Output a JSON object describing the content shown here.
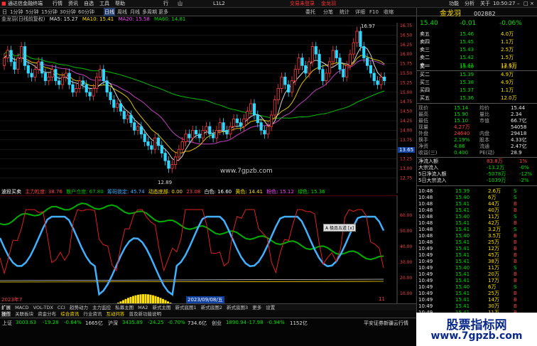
{
  "menu": {
    "app_title": "通达信金融终端",
    "items": [
      "行情",
      "资讯",
      "自选",
      "工具",
      "帮助",
      "行",
      "山",
      "L1L2"
    ],
    "login": "交易未登录",
    "stock_short": "金龙羽",
    "right_items": [
      "功能",
      "分析",
      "关于",
      "三"
    ]
  },
  "toolbar": {
    "items": [
      "日",
      "1分钟",
      "5分钟",
      "15分钟",
      "30分钟",
      "60分钟",
      "日线",
      "周线",
      "月线",
      "多周期",
      "更多"
    ],
    "right_items": [
      "委托",
      "分笔",
      "统计",
      "详细",
      "F10",
      "收缩"
    ]
  },
  "chart": {
    "main_info": "金龙羽(日线前复权)",
    "ma5": "MA5: 15.27",
    "ma10": "MA10: 15.41",
    "ma20": "MA20: 15.58",
    "ma60": "MA60: 14.81",
    "high_label": "16.97",
    "low_label": "12.89",
    "price_ticks": [
      "16.75",
      "16.50",
      "16.25",
      "16.00",
      "15.75",
      "15.50",
      "15.25",
      "15.00",
      "14.75",
      "14.50",
      "14.25",
      "14.00",
      "13.75",
      "13.50",
      "13.25",
      "13.00",
      "12.75"
    ],
    "current_tag": "13.65",
    "watermark": "www.7gpzb.com",
    "ind_title": "波段买卖",
    "ind_items": [
      "主力粒度: 38.76",
      "散户仓度: 67.80",
      "筹码锁定: 45.74",
      "动态底部: 0.00",
      "23.08",
      "白色: 16.60",
      "黄色: 14.41",
      "粉色: 15.12",
      "绿色: 15.36"
    ],
    "ind_ticks": [
      "60.00",
      "50.00",
      "40.00",
      "30.00",
      "20.00",
      "10.00"
    ],
    "tooltip": "A 极品五道 [x]",
    "date_left": "2023年7",
    "date_mid": "2023/09/08/五",
    "date_right": "11",
    "tabs": [
      "扩展",
      "MACD",
      "VOL-TDX",
      "CCI",
      "趋势动力",
      "主力监控",
      "私募主图",
      "MA2",
      "新式主图",
      "新式底图1",
      "新式底图2",
      "新式底图3",
      "更多",
      "设置"
    ],
    "tabs2": [
      "操作",
      "关联板块",
      "资金分布",
      "综合资讯",
      "行业资讯",
      "互动问答",
      "普及新功能说明"
    ]
  },
  "quote": {
    "name": "金龙羽",
    "code": "002882",
    "price": "15.40",
    "change": "-0.01",
    "pct": "-0.06%",
    "asks": [
      {
        "label": "卖五",
        "price": "15.46",
        "vol": "4.0万"
      },
      {
        "label": "卖四",
        "price": "15.45",
        "vol": "1.1万"
      },
      {
        "label": "卖三",
        "price": "15.43",
        "vol": "2.5万"
      },
      {
        "label": "卖二",
        "price": "15.42",
        "vol": "1.5万"
      },
      {
        "label": "卖一",
        "price": "15.41",
        "vol": "12.6万"
      }
    ],
    "bids": [
      {
        "label": "买一",
        "price": "15.40",
        "vol": "12.3万"
      },
      {
        "label": "买二",
        "price": "15.39",
        "vol": "4.9万"
      },
      {
        "label": "买三",
        "price": "15.38",
        "vol": "4.9万"
      },
      {
        "label": "买四",
        "price": "15.37",
        "vol": "1.1万"
      },
      {
        "label": "买五",
        "price": "15.36",
        "vol": "12.0万"
      }
    ],
    "stats": [
      {
        "l1": "现价",
        "v1": "15.14",
        "l2": "均价",
        "v2": "15.44"
      },
      {
        "l1": "最高",
        "v1": "15.90",
        "l2": "量比",
        "v2": "2.34"
      },
      {
        "l1": "最低",
        "v1": "15.10",
        "l2": "市值",
        "v2": "66.7亿"
      },
      {
        "l1": "现量",
        "v1": "4.27万",
        "l2": "",
        "v2": "54058"
      },
      {
        "l1": "外盘",
        "v1": "24640",
        "l2": "内盘",
        "v2": "29418"
      },
      {
        "l1": "换手",
        "v1": "2.19%",
        "l2": "股本",
        "v2": "4.33亿"
      },
      {
        "l1": "净资",
        "v1": "4.86",
        "l2": "流通",
        "v2": "2.47亿"
      },
      {
        "l1": "收益(三)",
        "v1": "0.400",
        "l2": "PE(动)",
        "v2": "28.9"
      }
    ],
    "flows": [
      {
        "label": "净流入额",
        "v": "83.8万",
        "p": "1%"
      },
      {
        "label": "大宗流入",
        "v": "-13.2万",
        "p": "-0%"
      },
      {
        "label": "5日净流入额",
        "v": "-5078万",
        "p": "-12%"
      },
      {
        "label": "5日大宗流入",
        "v": "-1039万",
        "p": "-2%"
      }
    ],
    "ticks": [
      {
        "t": "10:48",
        "p": "15.39",
        "v": "2.6万",
        "d": "S"
      },
      {
        "t": "10:48",
        "p": "15.40",
        "v": "6万",
        "d": "S"
      },
      {
        "t": "10:48",
        "p": "15.41",
        "v": "44万",
        "d": "B"
      },
      {
        "t": "10:48",
        "p": "15.41",
        "v": "40万",
        "d": "B"
      },
      {
        "t": "10:48",
        "p": "15.40",
        "v": "11万",
        "d": "S"
      },
      {
        "t": "10:48",
        "p": "15.41",
        "v": "42万",
        "d": "B"
      },
      {
        "t": "10:48",
        "p": "15.41",
        "v": "3.2万",
        "d": "S"
      },
      {
        "t": "10:48",
        "p": "15.40",
        "v": "3.5万",
        "d": "B"
      },
      {
        "t": "10:48",
        "p": "15.41",
        "v": "25万",
        "d": "B"
      },
      {
        "t": "10:49",
        "p": "15.41",
        "v": "12万",
        "d": "B"
      },
      {
        "t": "10:49",
        "p": "15.41",
        "v": "45万",
        "d": "B"
      },
      {
        "t": "10:49",
        "p": "15.41",
        "v": "38万",
        "d": "B"
      },
      {
        "t": "10:49",
        "p": "15.40",
        "v": "11万",
        "d": "S"
      },
      {
        "t": "10:49",
        "p": "15.41",
        "v": "20万",
        "d": "B"
      },
      {
        "t": "10:49",
        "p": "15.41",
        "v": "17万",
        "d": "B"
      },
      {
        "t": "10:49",
        "p": "15.40",
        "v": "6万",
        "d": "S"
      },
      {
        "t": "10:49",
        "p": "15.41",
        "v": "25万",
        "d": "B"
      },
      {
        "t": "10:49",
        "p": "15.41",
        "v": "14万",
        "d": "B"
      },
      {
        "t": "10:49",
        "p": "15.41",
        "v": "30万",
        "d": "B"
      },
      {
        "t": "10:49",
        "p": "15.41",
        "v": "11万",
        "d": "B"
      }
    ]
  },
  "status": {
    "sh_name": "上证",
    "sh_val": "3003.63",
    "sh_chg": "-19.28",
    "sh_pct": "-0.64%",
    "sh_amt": "1665亿",
    "sz_name": "沪深",
    "sz_val": "3435.89",
    "sz_chg": "-24.25",
    "sz_pct": "-0.70%",
    "sz_amt": "734.6亿",
    "cy_name": "创业",
    "cy_val": "1890.94",
    "cy_chg": "-17.98",
    "cy_pct": "-0.94%",
    "cy_amt": "1152亿",
    "broker": "平安证券新疆云行情",
    "time": "10:50:27"
  },
  "watermark2": {
    "line1": "股票指标网",
    "line2": "www.7gpzb.com"
  },
  "colors": {
    "up": "#ff4040",
    "down": "#00e000",
    "ma5": "#e8e8e8",
    "ma10": "#ffe000",
    "ma20": "#ff40ff",
    "ma60": "#00e000"
  }
}
